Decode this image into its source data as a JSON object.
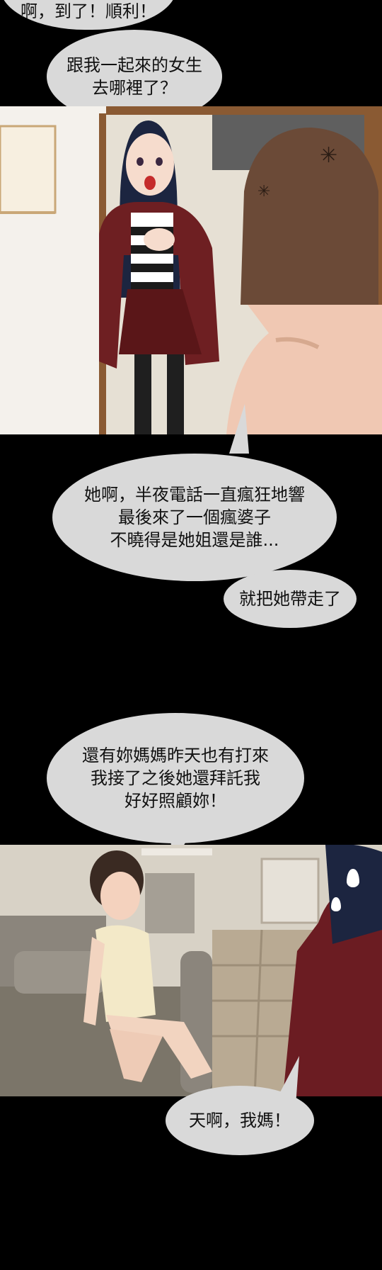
{
  "bubbles": {
    "top_fragment": "啊，到了！順利！",
    "girl_question": [
      "跟我一起來的女生",
      "去哪裡了？"
    ],
    "landlady_explain": [
      "她啊，半夜電話一直瘋狂地響",
      "最後來了一個瘋婆子",
      "不曉得是她姐還是誰..."
    ],
    "took_her": "就把她帶走了",
    "mom_call": [
      "還有妳媽媽昨天也有打來",
      "我接了之後她還拜託我",
      "好好照顧妳！"
    ],
    "oh_my_mom": "天啊，我媽！"
  },
  "colors": {
    "bubble": "#d9d9d9",
    "background": "#000000",
    "girl_jacket": "#6e1f22",
    "girl_hair": "#1c2540",
    "landlady_dress": "#f3e9c8"
  },
  "icons": [
    "anger-mark-icon",
    "sweat-drop-icon"
  ]
}
